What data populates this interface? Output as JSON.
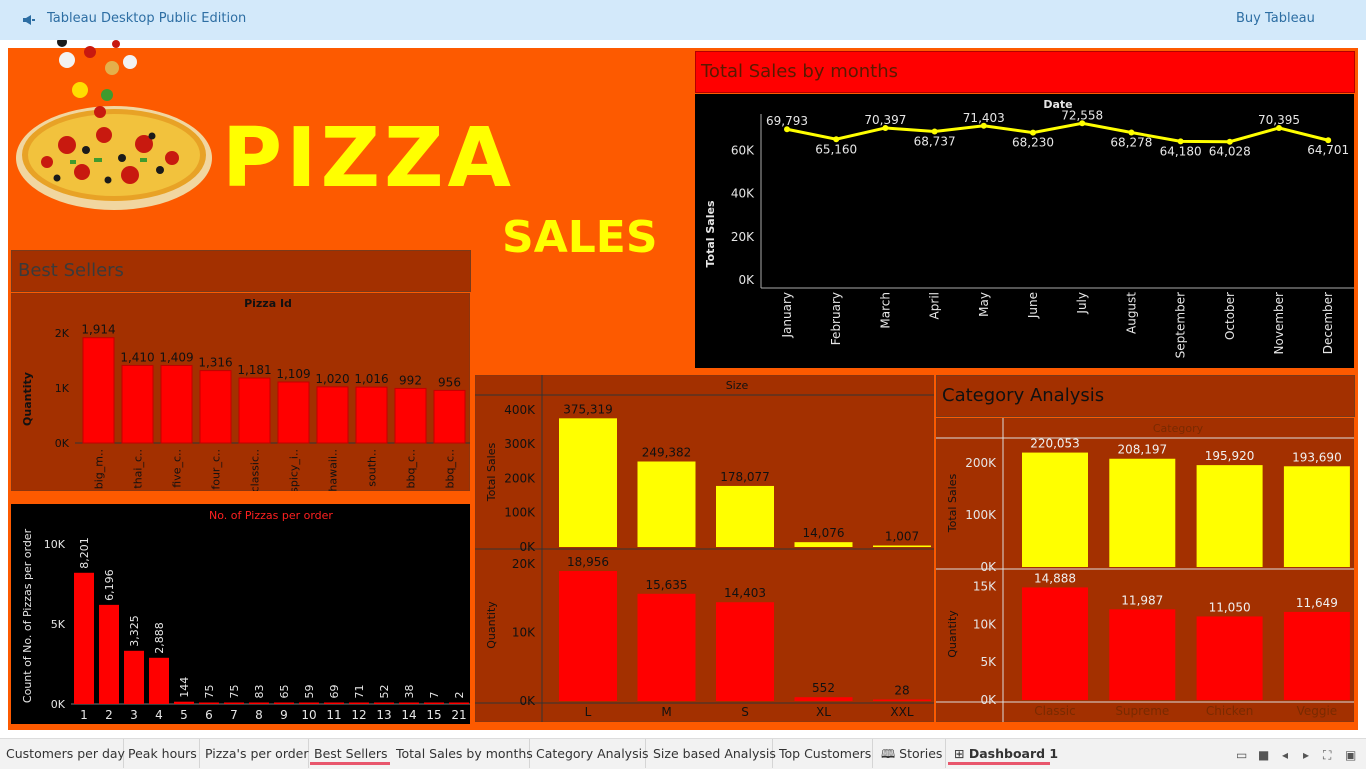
{
  "app": {
    "title": "Tableau Desktop Public Edition",
    "buy_label": "Buy Tableau",
    "colors": {
      "topbar_bg": "#d3e9fa",
      "dashboard_bg": "#fd5a00",
      "panel_bg": "#a33000",
      "accent_red": "#ff0000",
      "accent_yellow": "#ffff00"
    }
  },
  "hero": {
    "line1": "PIZZA",
    "line2": "SALES"
  },
  "best_sellers": {
    "header": "Best Sellers",
    "chart_title": "Pizza Id",
    "y_label": "Quantity"
  },
  "pizzas_per_order": {
    "chart_title": "No. of Pizzas per order",
    "y_label": "Count of No. of Pizzas per order"
  },
  "monthly": {
    "header": "Total Sales by months",
    "chart_title": "Date",
    "y_label": "Total Sales"
  },
  "size": {
    "chart_title": "Size",
    "y_label_top": "Total Sales",
    "y_label_bottom": "Quantity"
  },
  "category": {
    "header": "Category Analysis",
    "chart_title": "Category",
    "y_label_top": "Total Sales",
    "y_label_bottom": "Quantity"
  },
  "chart_data": [
    {
      "type": "bar",
      "title": "Pizza Id",
      "ylabel": "Quantity",
      "categories": [
        "big_m..",
        "thai_c..",
        "five_c..",
        "four_c..",
        "classic..",
        "spicy_i..",
        "hawaii..",
        "south..",
        "bbq_c..",
        "bbq_c.."
      ],
      "values": [
        1914,
        1410,
        1409,
        1316,
        1181,
        1109,
        1020,
        1016,
        992,
        956
      ],
      "labels": [
        "1,914",
        "1,410",
        "1,409",
        "1,316",
        "1,181",
        "1,109",
        "1,020",
        "1,016",
        "992",
        "956"
      ],
      "yticks": [
        "2K",
        "1K",
        "0K"
      ],
      "ylim": [
        0,
        2000
      ]
    },
    {
      "type": "bar",
      "title": "No. of Pizzas per order",
      "ylabel": "Count of No. of Pizzas per order",
      "categories": [
        "1",
        "2",
        "3",
        "4",
        "5",
        "6",
        "7",
        "8",
        "9",
        "10",
        "11",
        "12",
        "13",
        "14",
        "15",
        "21"
      ],
      "values": [
        8201,
        6196,
        3325,
        2888,
        144,
        75,
        75,
        83,
        65,
        59,
        69,
        71,
        52,
        38,
        7,
        2
      ],
      "labels": [
        "8,201",
        "6,196",
        "3,325",
        "2,888",
        "144",
        "75",
        "75",
        "83",
        "65",
        "59",
        "69",
        "71",
        "52",
        "38",
        "7",
        "2"
      ],
      "yticks": [
        "10K",
        "5K",
        "0K"
      ],
      "ylim": [
        0,
        10000
      ]
    },
    {
      "type": "line",
      "title": "Date",
      "ylabel": "Total Sales",
      "categories": [
        "January",
        "February",
        "March",
        "April",
        "May",
        "June",
        "July",
        "August",
        "September",
        "October",
        "November",
        "December"
      ],
      "values": [
        69793,
        65160,
        70397,
        68737,
        71403,
        68230,
        72558,
        68278,
        64180,
        64028,
        70395,
        64701
      ],
      "labels": [
        "69,793",
        "65,160",
        "70,397",
        "68,737",
        "71,403",
        "68,230",
        "72,558",
        "68,278",
        "64,180",
        "64,028",
        "70,395",
        "64,701"
      ],
      "yticks": [
        "60K",
        "40K",
        "20K",
        "0K"
      ],
      "ylim": [
        0,
        75000
      ]
    },
    {
      "type": "bar",
      "title": "Size",
      "categories": [
        "L",
        "M",
        "S",
        "XL",
        "XXL"
      ],
      "series": [
        {
          "name": "Total Sales",
          "values": [
            375319,
            249382,
            178077,
            14076,
            1007
          ],
          "labels": [
            "375,319",
            "249,382",
            "178,077",
            "14,076",
            "1,007"
          ],
          "yticks": [
            "400K",
            "300K",
            "200K",
            "100K",
            "0K"
          ],
          "ylim": [
            0,
            420000
          ]
        },
        {
          "name": "Quantity",
          "values": [
            18956,
            15635,
            14403,
            552,
            28
          ],
          "labels": [
            "18,956",
            "15,635",
            "14,403",
            "552",
            "28"
          ],
          "yticks": [
            "20K",
            "10K",
            "0K"
          ],
          "ylim": [
            0,
            21000
          ]
        }
      ]
    },
    {
      "type": "bar",
      "title": "Category",
      "categories": [
        "Classic",
        "Supreme",
        "Chicken",
        "Veggie"
      ],
      "series": [
        {
          "name": "Total Sales",
          "values": [
            220053,
            208197,
            195920,
            193690
          ],
          "labels": [
            "220,053",
            "208,197",
            "195,920",
            "193,690"
          ],
          "yticks": [
            "200K",
            "100K",
            "0K"
          ],
          "ylim": [
            0,
            225000
          ]
        },
        {
          "name": "Quantity",
          "values": [
            14888,
            11987,
            11050,
            11649
          ],
          "labels": [
            "14,888",
            "11,987",
            "11,050",
            "11,649"
          ],
          "yticks": [
            "15K",
            "10K",
            "5K",
            "0K"
          ],
          "ylim": [
            0,
            16000
          ]
        }
      ]
    }
  ],
  "tabs": [
    {
      "label": "Customers per day"
    },
    {
      "label": "Peak hours"
    },
    {
      "label": "Pizza's per order"
    },
    {
      "label": "Best Sellers"
    },
    {
      "label": "Total Sales by months"
    },
    {
      "label": "Category Analysis"
    },
    {
      "label": "Size based Analysis"
    },
    {
      "label": "Top Customers"
    },
    {
      "label": "Stories"
    },
    {
      "label": "Dashboard 1"
    }
  ]
}
